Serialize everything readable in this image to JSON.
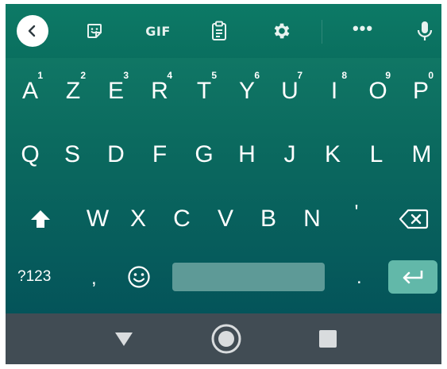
{
  "toolbar": {
    "back_icon": "chevron-left-icon",
    "sticker_icon": "sticker-icon",
    "gif_label": "GIF",
    "clipboard_icon": "clipboard-icon",
    "settings_icon": "gear-icon",
    "more_label": "•••",
    "mic_icon": "microphone-icon"
  },
  "rows": {
    "row1": [
      {
        "label": "A",
        "hint": "1"
      },
      {
        "label": "Z",
        "hint": "2"
      },
      {
        "label": "E",
        "hint": "3"
      },
      {
        "label": "R",
        "hint": "4"
      },
      {
        "label": "T",
        "hint": "5"
      },
      {
        "label": "Y",
        "hint": "6"
      },
      {
        "label": "U",
        "hint": "7"
      },
      {
        "label": "I",
        "hint": "8"
      },
      {
        "label": "O",
        "hint": "9"
      },
      {
        "label": "P",
        "hint": "0"
      }
    ],
    "row2": [
      "Q",
      "S",
      "D",
      "F",
      "G",
      "H",
      "J",
      "K",
      "L",
      "M"
    ],
    "row3": [
      "W",
      "X",
      "C",
      "V",
      "B",
      "N",
      "'"
    ]
  },
  "bottom_row": {
    "symbols_label": "?123",
    "comma_label": ",",
    "period_label": ".",
    "emoji_icon": "smiley-icon",
    "enter_icon": "enter-arrow-icon"
  },
  "colors": {
    "keyboard_top": "#137e68",
    "keyboard_bottom": "#04545a",
    "space_bar": "#5e9a97",
    "enter_key": "#62b8a9",
    "nav_bar": "#414c54"
  },
  "navbar": {
    "back_icon": "triangle-back-icon",
    "home_icon": "home-circle-icon",
    "recents_icon": "square-recents-icon"
  }
}
